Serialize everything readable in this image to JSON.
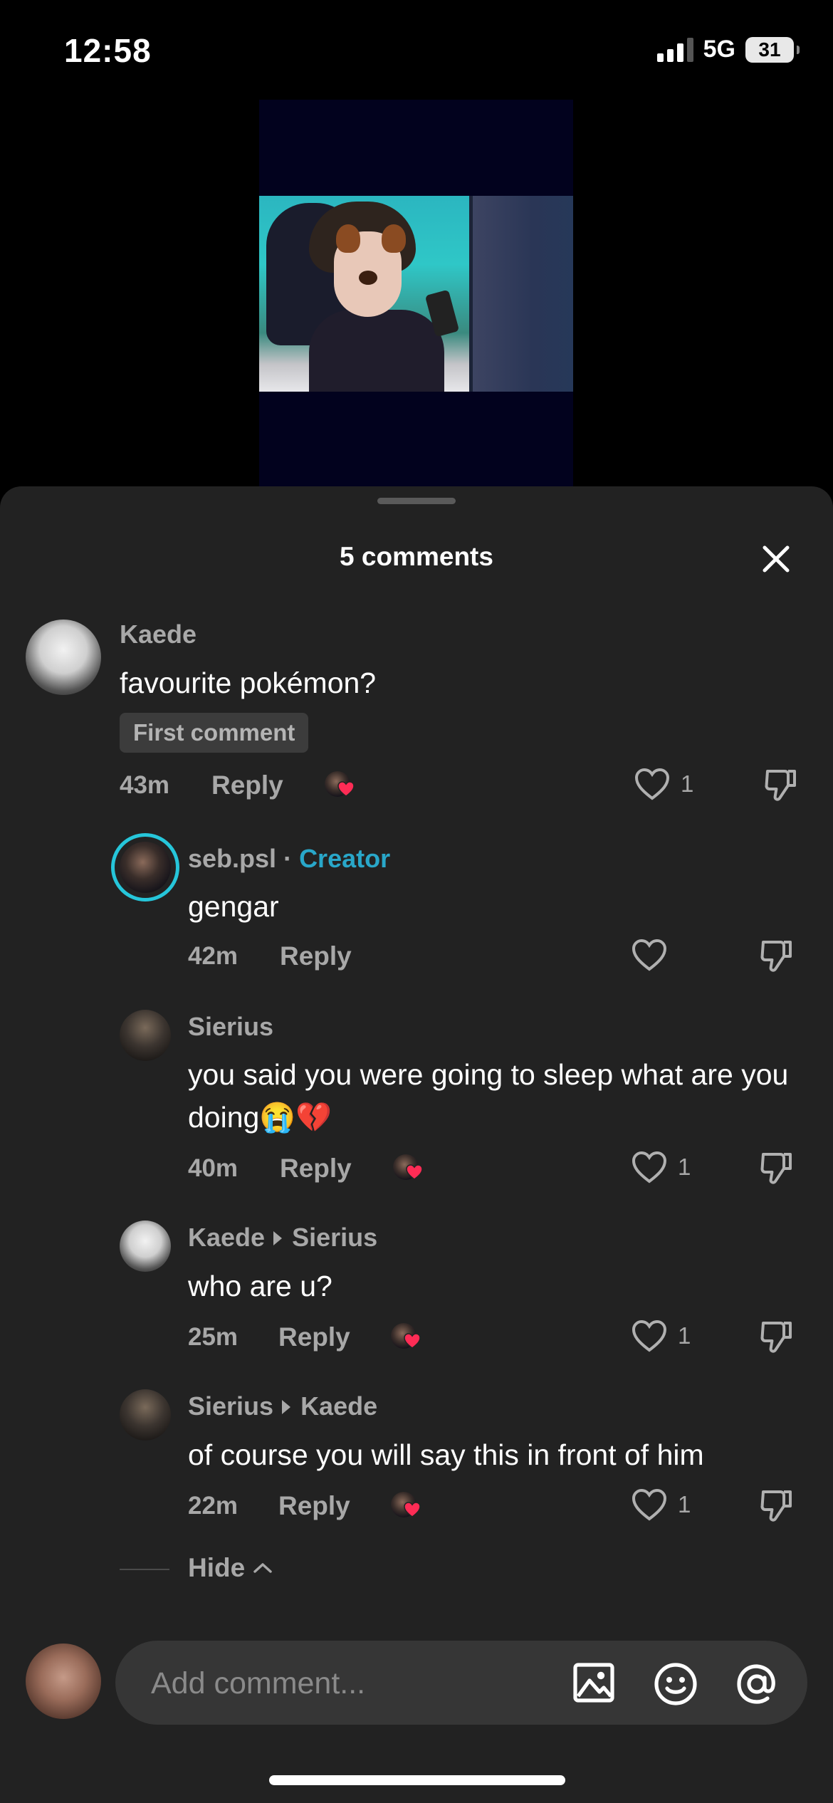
{
  "status_bar": {
    "time": "12:58",
    "network": "5G",
    "battery": "31"
  },
  "comments_sheet": {
    "title": "5 comments",
    "comments": [
      {
        "username": "Kaede",
        "text": "favourite pokémon?",
        "badge": "First comment",
        "time": "43m",
        "reply_label": "Reply",
        "likes": "1"
      },
      {
        "username": "seb.psl",
        "separator": " · ",
        "creator_label": "Creator",
        "text": "gengar",
        "time": "42m",
        "reply_label": "Reply"
      },
      {
        "username": "Sierius",
        "text": "you said you were going to sleep what are you doing😭💔",
        "time": "40m",
        "reply_label": "Reply",
        "likes": "1"
      },
      {
        "username": "Kaede",
        "reply_to": "Sierius",
        "text": "who are u?",
        "time": "25m",
        "reply_label": "Reply",
        "likes": "1"
      },
      {
        "username": "Sierius",
        "reply_to": "Kaede",
        "text": "of course you will say this in front of him",
        "time": "22m",
        "reply_label": "Reply",
        "likes": "1"
      }
    ],
    "hide_label": "Hide"
  },
  "comment_input": {
    "placeholder": "Add comment..."
  },
  "colors": {
    "sheet_bg": "#222222",
    "creator_accent": "#29a7c9",
    "heart_red": "#fe2c55"
  },
  "icons": [
    "close-icon",
    "heart-icon",
    "dislike-icon",
    "image-icon",
    "emoji-icon",
    "mention-icon",
    "chevron-up-icon"
  ]
}
